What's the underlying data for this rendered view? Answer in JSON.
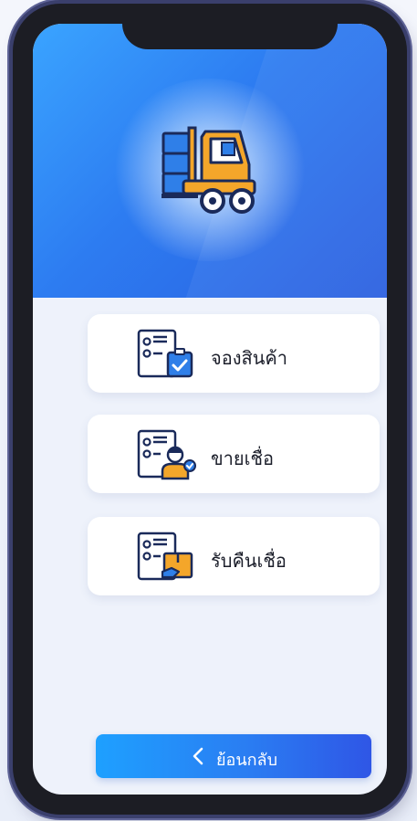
{
  "menu": {
    "items": [
      {
        "label": "จองสินค้า",
        "icon": "checklist-clipboard-icon"
      },
      {
        "label": "ขายเชื่อ",
        "icon": "checklist-salesperson-icon"
      },
      {
        "label": "รับคืนเชื่อ",
        "icon": "checklist-box-return-icon"
      }
    ]
  },
  "hero": {
    "icon": "forklift-icon",
    "colors": {
      "from": "#3aa4ff",
      "to": "#2b5fe0"
    }
  },
  "back_button": {
    "label": "ย้อนกลับ",
    "icon": "chevron-left-icon"
  },
  "colors": {
    "accent": "#2a7df2",
    "card_icon_blue": "#2f7fe8",
    "card_icon_orange": "#f4a62a",
    "screen_background": "#eef2fb"
  }
}
